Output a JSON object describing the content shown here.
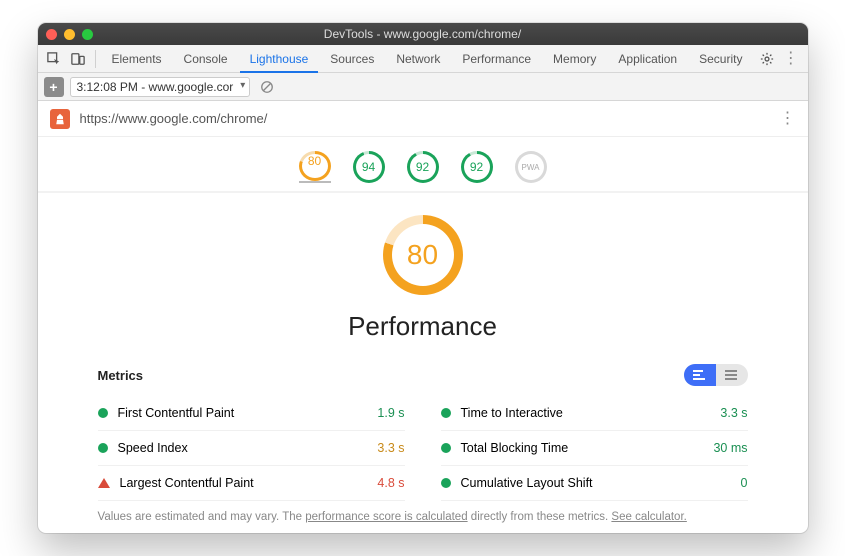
{
  "titlebar": {
    "title": "DevTools - www.google.com/chrome/"
  },
  "tabs": {
    "items": [
      "Elements",
      "Console",
      "Lighthouse",
      "Sources",
      "Network",
      "Performance",
      "Memory",
      "Application",
      "Security"
    ],
    "active_index": 2
  },
  "toolbar": {
    "timestamp_label": "3:12:08 PM - www.google.cor"
  },
  "url_bar": {
    "url": "https://www.google.com/chrome/"
  },
  "score_gauges": [
    {
      "value": "80",
      "cls": "orange",
      "ringcls": "orange",
      "active": true
    },
    {
      "value": "94",
      "cls": "green",
      "ringcls": "green94",
      "active": false
    },
    {
      "value": "92",
      "cls": "green",
      "ringcls": "green92",
      "active": false
    },
    {
      "value": "92",
      "cls": "green",
      "ringcls": "green92",
      "active": false
    },
    {
      "value": "PWA",
      "cls": "gray",
      "ringcls": "gray",
      "active": false
    }
  ],
  "main_gauge": {
    "value": "80",
    "title": "Performance"
  },
  "metrics": {
    "heading": "Metrics",
    "items": [
      {
        "label": "First Contentful Paint",
        "value": "1.9 s",
        "ind": "good",
        "valcls": "good"
      },
      {
        "label": "Time to Interactive",
        "value": "3.3 s",
        "ind": "good",
        "valcls": "good"
      },
      {
        "label": "Speed Index",
        "value": "3.3 s",
        "ind": "good",
        "valcls": "avg"
      },
      {
        "label": "Total Blocking Time",
        "value": "30 ms",
        "ind": "good",
        "valcls": "good"
      },
      {
        "label": "Largest Contentful Paint",
        "value": "4.8 s",
        "ind": "bad",
        "valcls": "bad"
      },
      {
        "label": "Cumulative Layout Shift",
        "value": "0",
        "ind": "good",
        "valcls": "good"
      }
    ]
  },
  "footer_note": {
    "pre": "Values are estimated and may vary. The ",
    "link1": "performance score is calculated",
    "mid": " directly from these metrics. ",
    "link2": "See calculator."
  }
}
